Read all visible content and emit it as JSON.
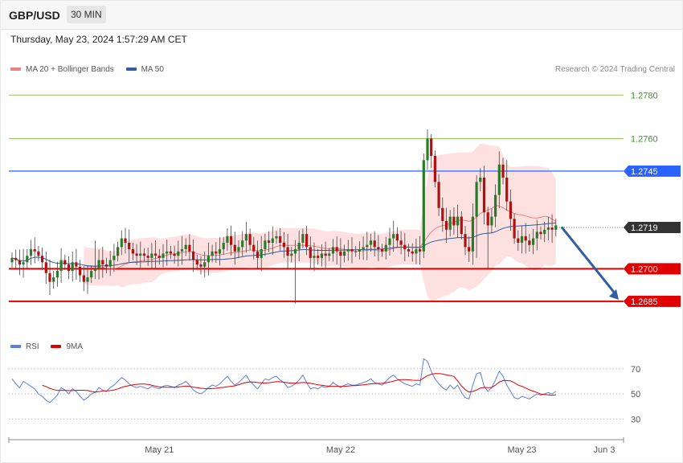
{
  "header": {
    "symbol": "GBP/USD",
    "timeframe": "30 MIN"
  },
  "datetime": "Thursday, May 23, 2024 1:57:29 AM CET",
  "legend_main": [
    {
      "label": "MA 20 + Bollinger Bands",
      "color": "#f08080"
    },
    {
      "label": "MA 50",
      "color": "#2f5f9e"
    }
  ],
  "legend_rsi": [
    {
      "label": "RSI",
      "color": "#5b7fde"
    },
    {
      "label": "9MA",
      "color": "#e00000"
    }
  ],
  "credit": "Research © 2024 Trading Central",
  "colors": {
    "bull": "#2a7a2a",
    "bear": "#b01010",
    "resistance": "#8fbf50",
    "pivot": "#2962ff",
    "support": "#e00000",
    "current": "#333333",
    "forecast_arrow": "#2f5f9e"
  },
  "chart_data": [
    {
      "type": "candlestick",
      "ylim": [
        1.2672,
        1.2789
      ],
      "levels": [
        {
          "value": 1.278,
          "label": "1.2780",
          "kind": "resistance"
        },
        {
          "value": 1.276,
          "label": "1.2760",
          "kind": "resistance"
        },
        {
          "value": 1.2745,
          "label": "1.2745",
          "kind": "pivot"
        },
        {
          "value": 1.2719,
          "label": "1.2719",
          "kind": "current"
        },
        {
          "value": 1.27,
          "label": "1.2700",
          "kind": "support"
        },
        {
          "value": 1.2685,
          "label": "1.2685",
          "kind": "support"
        }
      ],
      "x_ticks": [
        {
          "index": 39,
          "label": "May 21"
        },
        {
          "index": 87,
          "label": "May 22"
        },
        {
          "index": 135,
          "label": "May 23"
        },
        {
          "label": "Jun 3"
        }
      ],
      "closes": [
        1.2705,
        1.2704,
        1.2702,
        1.2703,
        1.2706,
        1.2709,
        1.2708,
        1.2706,
        1.2703,
        1.2698,
        1.2694,
        1.2696,
        1.2699,
        1.2704,
        1.2702,
        1.2699,
        1.2703,
        1.2701,
        1.2697,
        1.2694,
        1.2696,
        1.2699,
        1.27,
        1.2704,
        1.2702,
        1.2701,
        1.2704,
        1.2706,
        1.271,
        1.2714,
        1.2712,
        1.2709,
        1.2707,
        1.2706,
        1.2707,
        1.2706,
        1.2705,
        1.2707,
        1.2706,
        1.2705,
        1.2707,
        1.2708,
        1.2707,
        1.2706,
        1.2708,
        1.2709,
        1.2711,
        1.2708,
        1.2704,
        1.2702,
        1.2701,
        1.2703,
        1.2706,
        1.2708,
        1.2707,
        1.2709,
        1.2712,
        1.2715,
        1.2711,
        1.2708,
        1.271,
        1.2713,
        1.2716,
        1.2711,
        1.2708,
        1.2705,
        1.2709,
        1.2713,
        1.2712,
        1.2714,
        1.2715,
        1.2712,
        1.271,
        1.2706,
        1.2707,
        1.2709,
        1.2712,
        1.2716,
        1.271,
        1.2705,
        1.2706,
        1.2705,
        1.2707,
        1.2706,
        1.2707,
        1.271,
        1.2708,
        1.2706,
        1.2708,
        1.2709,
        1.2708,
        1.2708,
        1.2709,
        1.271,
        1.2711,
        1.2713,
        1.271,
        1.2709,
        1.2708,
        1.2711,
        1.2714,
        1.2716,
        1.2713,
        1.2711,
        1.2709,
        1.2708,
        1.2707,
        1.2709,
        1.2708,
        1.275,
        1.276,
        1.2752,
        1.274,
        1.2728,
        1.2722,
        1.2718,
        1.2724,
        1.272,
        1.2724,
        1.2716,
        1.271,
        1.2708,
        1.2724,
        1.274,
        1.2742,
        1.2726,
        1.272,
        1.2724,
        1.2734,
        1.2748,
        1.2742,
        1.2731,
        1.2723,
        1.2714,
        1.2712,
        1.2715,
        1.2713,
        1.2711,
        1.2714,
        1.2717,
        1.2716,
        1.2718,
        1.2719,
        1.2718,
        1.272
      ]
    },
    {
      "type": "line",
      "title": "RSI",
      "ylim": [
        18,
        82
      ],
      "y_ticks": [
        70,
        50,
        30
      ],
      "series": [
        {
          "name": "RSI",
          "values": [
            62,
            58,
            55,
            60,
            58,
            56,
            54,
            50,
            48,
            45,
            43,
            46,
            49,
            55,
            53,
            50,
            54,
            52,
            48,
            45,
            47,
            50,
            51,
            55,
            53,
            52,
            55,
            57,
            60,
            63,
            61,
            58,
            56,
            55,
            56,
            55,
            54,
            56,
            55,
            54,
            56,
            57,
            56,
            55,
            57,
            58,
            60,
            57,
            53,
            51,
            50,
            52,
            55,
            57,
            56,
            58,
            61,
            64,
            60,
            57,
            59,
            62,
            65,
            60,
            57,
            54,
            58,
            62,
            61,
            63,
            64,
            61,
            59,
            55,
            56,
            58,
            61,
            65,
            59,
            54,
            55,
            54,
            56,
            55,
            56,
            59,
            57,
            55,
            57,
            58,
            57,
            57,
            58,
            59,
            60,
            62,
            59,
            58,
            57,
            60,
            63,
            65,
            62,
            60,
            58,
            57,
            56,
            58,
            57,
            78,
            76,
            68,
            62,
            58,
            55,
            53,
            57,
            54,
            57,
            51,
            47,
            46,
            57,
            66,
            67,
            56,
            52,
            55,
            61,
            68,
            64,
            57,
            52,
            47,
            46,
            48,
            47,
            46,
            48,
            50,
            49,
            50,
            51,
            50,
            52
          ]
        },
        {
          "name": "9MA",
          "values": [
            null,
            null,
            null,
            null,
            null,
            null,
            null,
            null,
            56.8,
            55.9,
            54.4,
            53.4,
            52.7,
            52.8,
            52.8,
            52.6,
            52.6,
            52.8,
            52.9,
            52.9,
            52.6,
            51.9,
            51.5,
            51.8,
            52.3,
            52.4,
            52.6,
            53.1,
            54.0,
            55.1,
            56.0,
            56.6,
            57.2,
            57.6,
            57.9,
            57.9,
            57.5,
            56.9,
            56.2,
            55.5,
            55.3,
            55.3,
            55.3,
            55.4,
            55.5,
            55.8,
            56.2,
            56.0,
            55.4,
            55.0,
            54.5,
            54.2,
            54.1,
            54.2,
            54.5,
            54.9,
            55.2,
            55.6,
            56.0,
            56.4,
            57.3,
            58.3,
            59.1,
            59.5,
            59.4,
            59.0,
            58.8,
            58.6,
            58.9,
            59.3,
            59.7,
            59.6,
            59.3,
            58.8,
            58.6,
            58.6,
            58.8,
            59.1,
            58.9,
            58.4,
            57.9,
            57.2,
            56.9,
            56.4,
            56.1,
            56.0,
            56.0,
            55.9,
            56.0,
            56.3,
            56.6,
            56.6,
            56.9,
            57.2,
            57.6,
            58.0,
            58.2,
            58.3,
            58.4,
            58.8,
            59.4,
            60.2,
            60.9,
            61.3,
            61.4,
            61.2,
            60.9,
            60.8,
            60.7,
            62.7,
            64.5,
            65.6,
            66.1,
            66.2,
            65.8,
            65.1,
            64.6,
            63.9,
            60.3,
            56.4,
            53.4,
            51.5,
            51.9,
            53.0,
            54.7,
            55.1,
            54.9,
            55.1,
            57.0,
            59.4,
            60.6,
            60.6,
            60.3,
            58.9,
            57.0,
            56.0,
            54.6,
            53.2,
            52.2,
            51.1,
            49.9,
            49.4,
            49.2,
            48.9,
            49.2
          ]
        }
      ]
    }
  ]
}
